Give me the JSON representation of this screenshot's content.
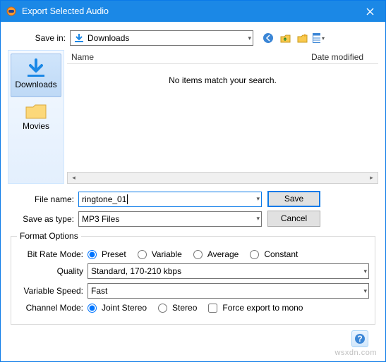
{
  "title": "Export Selected Audio",
  "save_in": {
    "label": "Save in:",
    "value": "Downloads"
  },
  "places": {
    "downloads": "Downloads",
    "movies": "Movies"
  },
  "filelist": {
    "col_name": "Name",
    "col_date": "Date modified",
    "empty": "No items match your search."
  },
  "filename": {
    "label": "File name:",
    "value": "ringtone_01"
  },
  "save_as_type": {
    "label": "Save as type:",
    "value": "MP3 Files"
  },
  "buttons": {
    "save": "Save",
    "cancel": "Cancel"
  },
  "format": {
    "legend": "Format Options",
    "bit_rate_mode": {
      "label": "Bit Rate Mode:",
      "options": {
        "preset": "Preset",
        "variable": "Variable",
        "average": "Average",
        "constant": "Constant"
      },
      "selected": "preset"
    },
    "quality": {
      "label": "Quality",
      "value": "Standard, 170-210 kbps"
    },
    "variable_speed": {
      "label": "Variable Speed:",
      "value": "Fast"
    },
    "channel_mode": {
      "label": "Channel Mode:",
      "options": {
        "joint_stereo": "Joint Stereo",
        "stereo": "Stereo"
      },
      "selected": "joint_stereo",
      "force_mono": "Force export to mono"
    }
  },
  "watermark": "wsxdn.com"
}
